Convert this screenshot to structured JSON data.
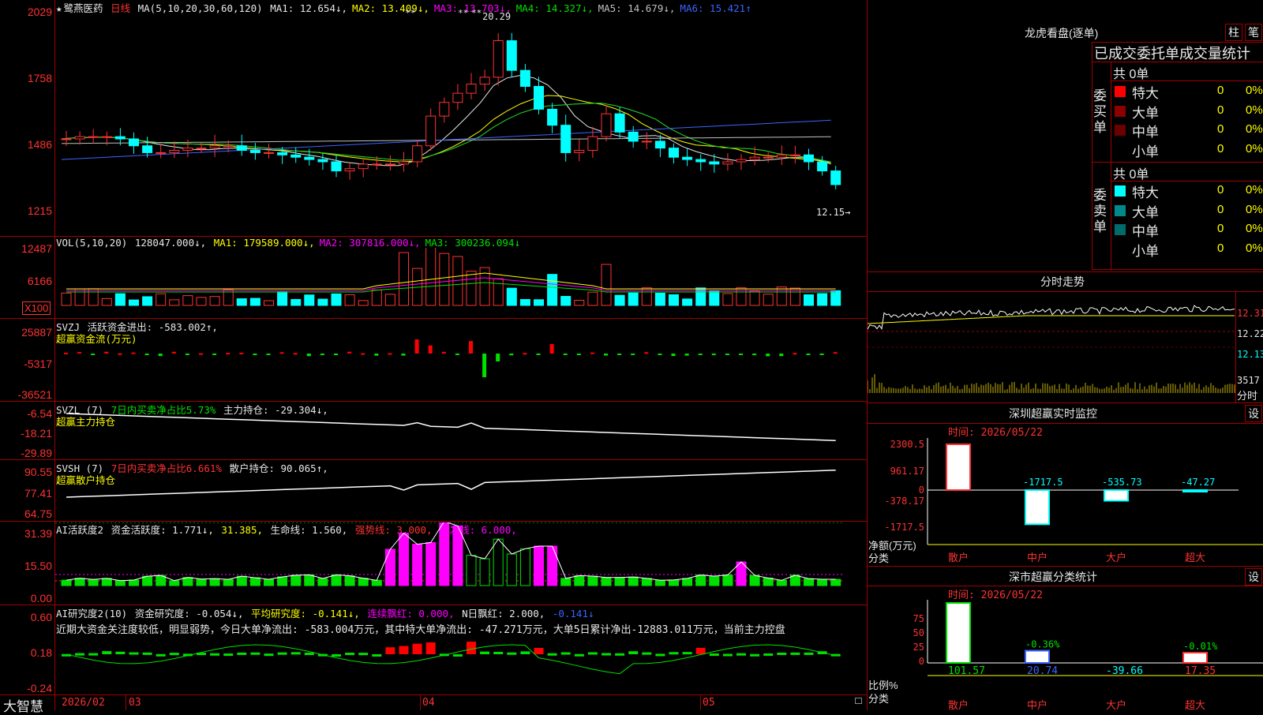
{
  "stock": {
    "star": "★",
    "name": "鹭燕医药",
    "period": "日线"
  },
  "main": {
    "ma_params": "MA(5,10,20,30,60,120)",
    "mas": [
      {
        "label": "MA1: 12.654↓,",
        "color": "#e8e8e8"
      },
      {
        "label": "MA2: 13.409↓,",
        "color": "#ffff00"
      },
      {
        "label": "MA3: 13.703↓,",
        "color": "#ff00ff"
      },
      {
        "label": "MA4: 14.327↓,",
        "color": "#00e000"
      },
      {
        "label": "MA5: 14.679↓,",
        "color": "#c0c0c0"
      },
      {
        "label": "MA6: 15.421↑",
        "color": "#3c64ff"
      }
    ],
    "y_labels": [
      "2029",
      "1758",
      "1486",
      "1215"
    ],
    "high_label": "20.29",
    "last_label": "12.15→",
    "stars": [
      "**",
      "**",
      "**"
    ]
  },
  "vol": {
    "title": "VOL(5,10,20)",
    "value": "128047.000↓,",
    "mas": [
      {
        "label": "MA1: 179589.000↓,",
        "color": "#ffff00"
      },
      {
        "label": "MA2: 307816.000↓,",
        "color": "#ff00ff"
      },
      {
        "label": "MA3: 300236.094↓",
        "color": "#00e000"
      }
    ],
    "y_labels": [
      "12487",
      "6166"
    ],
    "unit": "X100"
  },
  "svzj": {
    "title": "SVZJ",
    "line1": "活跃资金进出: -583.002↑,",
    "line2": "超赢资金流(万元)",
    "y_labels": [
      "25887",
      "-5317",
      "-36521"
    ]
  },
  "svzl": {
    "title": "SVZL (7)",
    "pct": "7日内买卖净占比5.73%",
    "hold": "主力持仓: -29.304↓,",
    "line2": "超赢主力持仓",
    "y_labels": [
      "-6.54",
      "-18.21",
      "-29.89"
    ]
  },
  "svsh": {
    "title": "SVSH (7)",
    "pct": "7日内买卖净占比6.661%",
    "hold": "散户持仓: 90.065↑,",
    "line2": "超赢散户持仓",
    "y_labels": [
      "90.55",
      "77.41",
      "64.75"
    ]
  },
  "ai1": {
    "title": "AI活跃度2",
    "a": "资金活跃度: 1.771↓,",
    "b": "31.385,",
    "c": "生命线: 1.560,",
    "d": "强势线: 3.000,",
    "e": "爆发线: 6.000,",
    "y_labels": [
      "31.39",
      "15.50",
      "0.00"
    ]
  },
  "ai2": {
    "title": "AI研究度2(10)",
    "a": "资金研究度: -0.054↓,",
    "b": "平均研究度: -0.141↓,",
    "c": "连续飘红: 0.000,",
    "d": "N日飘红: 2.000,",
    "e": "-0.141↓",
    "text": "近期大资金关注度较低，明显弱势，今日大单净流出: -583.004万元，其中特大单净流出: -47.271万元，大单5日累计净出-12883.011万元，当前主力控盘",
    "y_labels": [
      "0.60",
      "0.18",
      "-0.24"
    ]
  },
  "bottom": {
    "brand": "大智慧",
    "dates": [
      "2026/02",
      "03",
      "04",
      "05"
    ]
  },
  "lhb": {
    "title": "龙虎看盘(逐单)",
    "btn1": "柱",
    "btn2": "笔",
    "subtitle": "已成交委托单成交量统计",
    "buy_total": "共 0单",
    "buy_label": "委买单",
    "sell_total": "共 0单",
    "sell_label": "委卖单",
    "buy_rows": [
      {
        "name": "特大",
        "v": "0",
        "p": "0%",
        "c": "#ff0000"
      },
      {
        "name": "大单",
        "v": "0",
        "p": "0%",
        "c": "#8b0000"
      },
      {
        "name": "中单",
        "v": "0",
        "p": "0%",
        "c": "#6b0000"
      },
      {
        "name": "小单",
        "v": "0",
        "p": "0%",
        "c": ""
      }
    ],
    "sell_rows": [
      {
        "name": "特大",
        "v": "0",
        "p": "0%",
        "c": "#00ffff"
      },
      {
        "name": "大单",
        "v": "0",
        "p": "0%",
        "c": "#008b8b"
      },
      {
        "name": "中单",
        "v": "0",
        "p": "0%",
        "c": "#006b6b"
      },
      {
        "name": "小单",
        "v": "0",
        "p": "0%",
        "c": ""
      }
    ]
  },
  "fenshi": {
    "title": "分时走势",
    "p1": "12.31",
    "p2": "12.22",
    "p3": "12.13",
    "vol": "3517",
    "vlabel": "分时"
  },
  "sz_monitor": {
    "title": "深圳超赢实时监控",
    "btn": "设",
    "time": "时间: 2026/05/22",
    "y_labels": [
      "2300.5",
      "961.17",
      "0",
      "-378.17",
      "-1717.5"
    ],
    "ylab1": "净额(万元)",
    "ylab2": "分类",
    "values": [
      {
        "cat": "散户",
        "v": "2300.5",
        "num": 2300.5
      },
      {
        "cat": "中户",
        "v": "-1717.5",
        "num": -1717.5
      },
      {
        "cat": "大户",
        "v": "-535.73",
        "num": -535.73
      },
      {
        "cat": "超大",
        "v": "-47.27",
        "num": -47.27
      }
    ]
  },
  "sz_class": {
    "title": "深市超赢分类统计",
    "btn": "设",
    "time": "时间: 2026/05/22",
    "y_labels": [
      "75",
      "50",
      "25",
      "0"
    ],
    "ylab1": "比例%",
    "ylab2": "分类",
    "values": [
      {
        "cat": "散户",
        "v": "101.57",
        "top": "",
        "num": 101.57
      },
      {
        "cat": "中户",
        "v": "20.74",
        "top": "-0.36%",
        "num": 20.74
      },
      {
        "cat": "大户",
        "v": "-39.66",
        "top": "",
        "num": -39.66
      },
      {
        "cat": "超大",
        "v": "17.35",
        "top": "-0.01%",
        "num": 17.35
      }
    ]
  }
}
